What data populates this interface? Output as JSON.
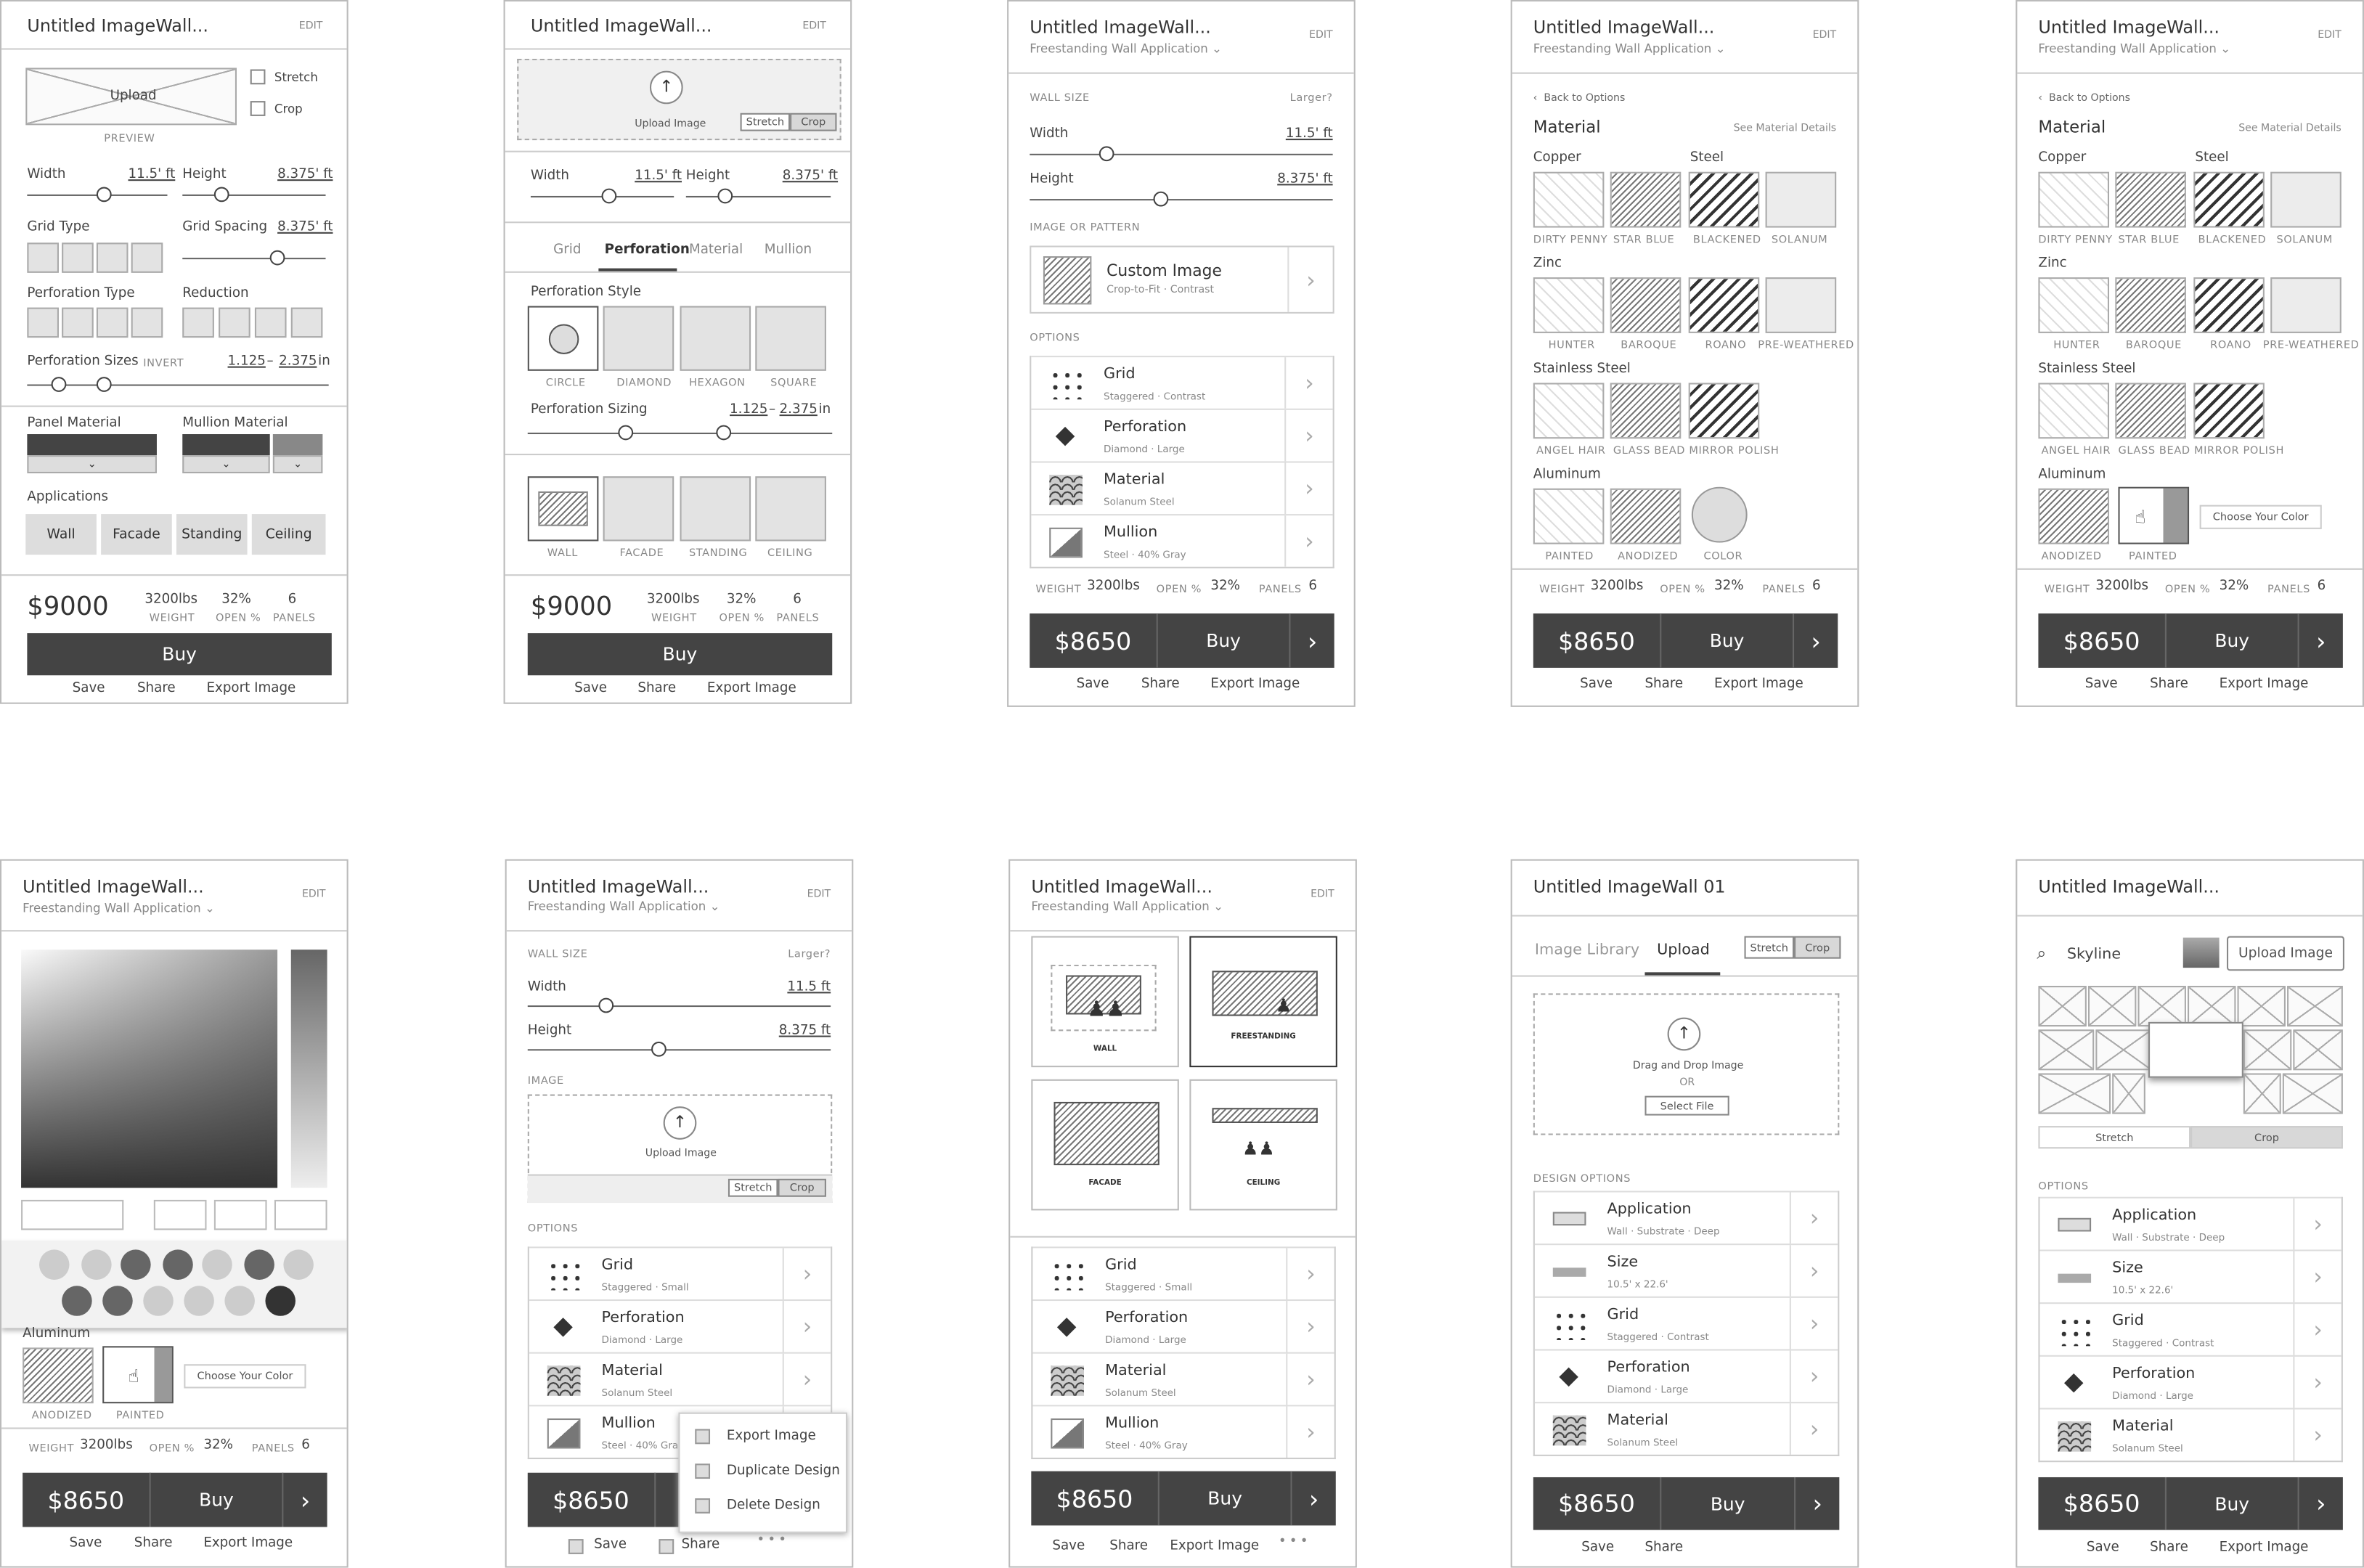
{
  "common": {
    "title": "Untitled ImageWall...",
    "edit": "EDIT",
    "subtitle": "Freestanding Wall Application",
    "save": "Save",
    "share": "Share",
    "export": "Export Image",
    "buy": "Buy",
    "weight": "WEIGHT",
    "open": "OPEN %",
    "panels": "PANELS",
    "wv": "3200lbs",
    "ov": "32%",
    "pv": "6",
    "price1": "$9000",
    "price2": "$8650"
  },
  "s1": {
    "stretch": "Stretch",
    "crop": "Crop",
    "upload": "Upload",
    "preview": "PREVIEW",
    "width": "Width",
    "wval": "11.5' ft",
    "height": "Height",
    "hval": "8.375' ft",
    "gridType": "Grid Type",
    "gridSpacing": "Grid Spacing",
    "gsval": "8.375' ft",
    "perfType": "Perforation Type",
    "reduction": "Reduction",
    "perfSizes": "Perforation Sizes",
    "invert": "INVERT",
    "ps1": "1.125",
    "ps2": "2.375",
    "psu": "in",
    "panelMat": "Panel Material",
    "mullionMat": "Mullion Material",
    "applications": "Applications",
    "apps": [
      "Wall",
      "Facade",
      "Standing",
      "Ceiling"
    ]
  },
  "s2": {
    "uploadImage": "Upload Image",
    "tabs": [
      "Grid",
      "Perforation",
      "Material",
      "Mullion"
    ],
    "perfStyle": "Perforation Style",
    "shapes": [
      "CIRCLE",
      "DIAMOND",
      "HEXAGON",
      "SQUARE"
    ],
    "perfSizing": "Perforation Sizing",
    "apps": [
      "WALL",
      "FACADE",
      "STANDING",
      "CEILING"
    ]
  },
  "s3": {
    "wallSize": "WALL SIZE",
    "larger": "Larger?",
    "imgPattern": "IMAGE OR PATTERN",
    "customImage": "Custom Image",
    "customSub": "Crop-to-Fit · Contrast",
    "options": "OPTIONS"
  },
  "opts": [
    {
      "t": "Grid",
      "s": "Staggered · Contrast"
    },
    {
      "t": "Perforation",
      "s": "Diamond · Large"
    },
    {
      "t": "Material",
      "s": "Solanum Steel"
    },
    {
      "t": "Mullion",
      "s": "Steel · 40% Gray"
    }
  ],
  "s4": {
    "back": "Back to Options",
    "material": "Material",
    "seeDetails": "See Material Details",
    "copper": "Copper",
    "steel": "Steel",
    "zinc": "Zinc",
    "stainless": "Stainless Steel",
    "aluminum": "Aluminum",
    "r1": [
      "DIRTY PENNY",
      "STAR BLUE",
      "BLACKENED",
      "SOLANUM"
    ],
    "r2": [
      "HUNTER",
      "BAROQUE",
      "ROANO",
      "PRE-WEATHERED"
    ],
    "r3": [
      "ANGEL HAIR",
      "GLASS BEAD MIRROR POLISH"
    ],
    "r4": [
      "PAINTED",
      "ANODIZED",
      "COLOR"
    ],
    "r4b": [
      "ANODIZED",
      "PAINTED"
    ],
    "chooseColor": "Choose Your Color"
  },
  "s7": {
    "width": "Width",
    "wv": "11.5 ft",
    "height": "Height",
    "hv": "8.375 ft",
    "image": "IMAGE",
    "grid": "Staggered · Small",
    "menu": [
      "Export Image",
      "Duplicate Design",
      "Delete Design"
    ],
    "stretch": "Stretch",
    "crop": "Crop"
  },
  "s8": {
    "apps": [
      "WALL",
      "FREESTANDING",
      "FACADE",
      "CEILING"
    ],
    "grid": "Staggered · Small"
  },
  "s9": {
    "title": "Untitled ImageWall 01",
    "lib": "Image Library",
    "upload": "Upload",
    "drag": "Drag and Drop Image",
    "or": "OR",
    "select": "Select File",
    "design": "DESIGN OPTIONS",
    "opts": [
      {
        "t": "Application",
        "s": "Wall · Substrate · Deep"
      },
      {
        "t": "Size",
        "s": "10.5' x 22.6'"
      },
      {
        "t": "Grid",
        "s": "Staggered · Contrast"
      },
      {
        "t": "Perforation",
        "s": "Diamond · Large"
      },
      {
        "t": "Material",
        "s": "Solanum Steel"
      }
    ]
  },
  "s10": {
    "search": "Skyline",
    "uploadImage": "Upload Image"
  }
}
